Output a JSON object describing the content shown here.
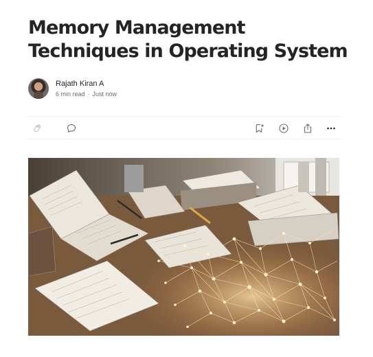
{
  "article": {
    "title": "Memory Management Techniques in Operating System"
  },
  "author": {
    "name": "Rajath Kiran A",
    "read_time": "6 min read",
    "separator": "·",
    "published": "Just now"
  },
  "actions": {
    "left": [
      "clap-icon",
      "comment-icon"
    ],
    "right": [
      "bookmark-add-icon",
      "play-listen-icon",
      "share-icon",
      "more-options-icon"
    ]
  },
  "colors": {
    "text": "#242424",
    "meta": "#6b6b6b",
    "divider": "#f0f0f0",
    "icon": "#6b6b6b"
  }
}
